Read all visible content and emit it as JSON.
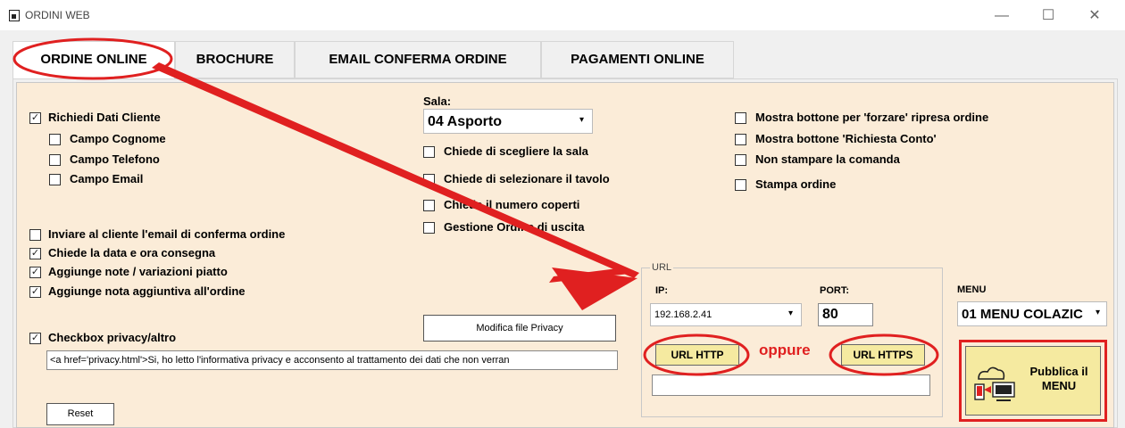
{
  "window": {
    "title": "ORDINI WEB"
  },
  "tabs": [
    {
      "label": "ORDINE ONLINE"
    },
    {
      "label": "BROCHURE"
    },
    {
      "label": "EMAIL CONFERMA ORDINE"
    },
    {
      "label": "PAGAMENTI ONLINE"
    }
  ],
  "left": {
    "richiedi_dati": {
      "label": "Richiedi Dati Cliente",
      "checked": true
    },
    "campi": [
      {
        "label": "Campo Cognome",
        "checked": false
      },
      {
        "label": "Campo Telefono",
        "checked": false
      },
      {
        "label": "Campo Email",
        "checked": false
      }
    ],
    "options": [
      {
        "label": "Inviare al cliente l'email di conferma ordine",
        "checked": false
      },
      {
        "label": "Chiede la data e ora consegna",
        "checked": true
      },
      {
        "label": "Aggiunge note / variazioni piatto",
        "checked": true
      },
      {
        "label": "Aggiunge nota aggiuntiva all'ordine",
        "checked": true
      }
    ],
    "privacy_checkbox": {
      "label": "Checkbox privacy/altro",
      "checked": true
    },
    "privacy_text": "<a href='privacy.html'>Si, ho letto l'informativa privacy e acconsento al trattamento dei dati che non verran",
    "reset_label": "Reset",
    "modifica_privacy_label": "Modifica file Privacy"
  },
  "sala": {
    "label": "Sala:",
    "value": "04 Asporto",
    "options": [
      {
        "label": "Chiede di scegliere la sala",
        "checked": false
      },
      {
        "label": "Chiede di selezionare il tavolo",
        "checked": false
      },
      {
        "label": "Chiede il numero coperti",
        "checked": false
      },
      {
        "label": "Gestione Ordine di uscita",
        "checked": false
      }
    ]
  },
  "right_options": [
    {
      "label": "Mostra bottone per 'forzare' ripresa ordine",
      "checked": false
    },
    {
      "label": "Mostra bottone 'Richiesta Conto'",
      "checked": false
    },
    {
      "label": "Non stampare la comanda",
      "checked": false
    },
    {
      "label": "Stampa ordine",
      "checked": false
    }
  ],
  "url": {
    "group_label": "URL",
    "ip_label": "IP:",
    "ip_value": "192.168.2.41",
    "port_label": "PORT:",
    "port_value": "80",
    "http_label": "URL HTTP",
    "https_label": "URL HTTPS",
    "or_label": "oppure",
    "url_value": ""
  },
  "menu": {
    "label": "MENU",
    "value": "01 MENU COLAZIC",
    "publish_label": "Pubblica il MENU"
  },
  "colors": {
    "annotation": "#e02020",
    "panel": "#fbecd8",
    "button_yellow": "#f5eaa0"
  },
  "icons": [
    "window-icon",
    "minimize-icon",
    "maximize-icon",
    "close-icon",
    "dropdown-arrow-icon",
    "checkmark-icon",
    "cloud-publish-icon"
  ]
}
